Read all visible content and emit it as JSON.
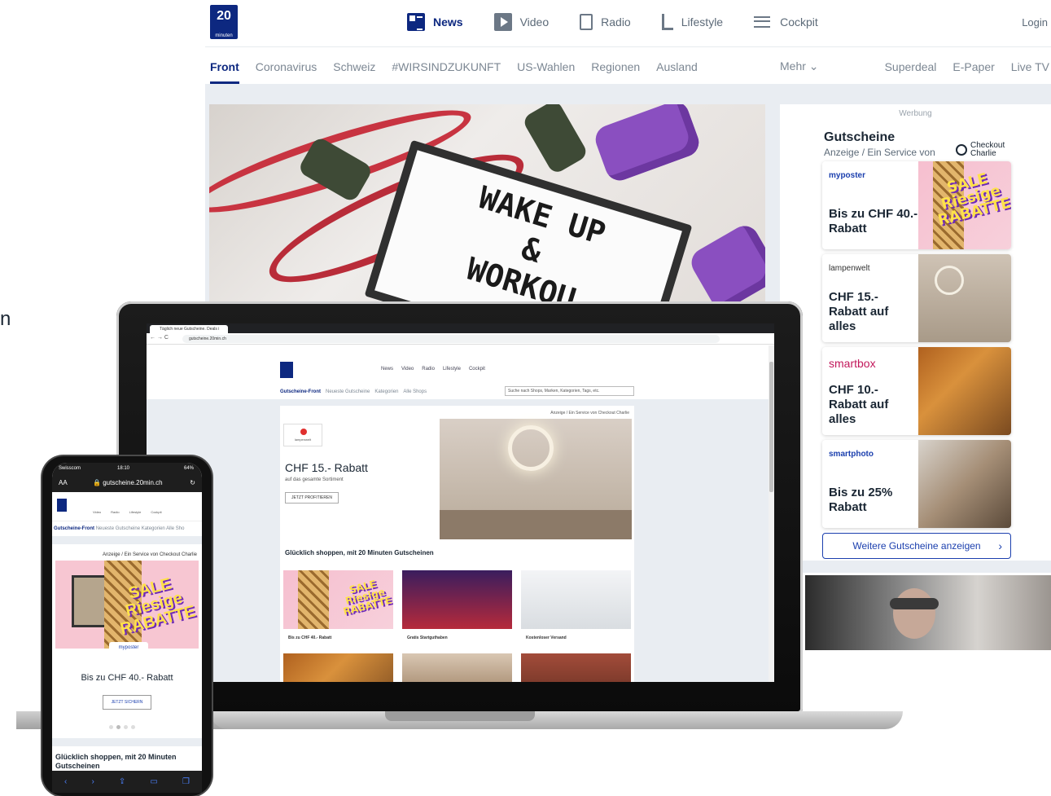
{
  "site": {
    "logo_text": "20",
    "logo_sub": "minuten",
    "nav": [
      {
        "label": "News",
        "icon": "news-icon"
      },
      {
        "label": "Video",
        "icon": "video-icon"
      },
      {
        "label": "Radio",
        "icon": "radio-icon"
      },
      {
        "label": "Lifestyle",
        "icon": "lifestyle-icon"
      },
      {
        "label": "Cockpit",
        "icon": "cockpit-icon"
      }
    ],
    "login": "Login",
    "tabs": [
      "Front",
      "Coronavirus",
      "Schweiz",
      "#WIRSINDZUKUNFT",
      "US-Wahlen",
      "Regionen",
      "Ausland"
    ],
    "mehr": "Mehr",
    "extra": [
      "Superdeal",
      "E-Paper",
      "Live TV"
    ],
    "hero_text_line1": "WAKE UP",
    "hero_text_line2": "&",
    "hero_text_line3": "WORKOU",
    "left_snip": "n"
  },
  "ad": {
    "werbung": "Werbung",
    "title": "Gutscheine",
    "subtitle": "Anzeige / Ein Service von",
    "partner_line1": "Checkout",
    "partner_line2": "Charlie",
    "cards": [
      {
        "brand": "myposter",
        "deal": "Bis zu CHF 40.- Rabatt",
        "image": "sale",
        "sale1": "SALE",
        "sale2": "Riesige",
        "sale3": "RABATTE"
      },
      {
        "brand": "lampenwelt",
        "deal": "CHF 15.- Rabatt auf alles",
        "image": "lamp"
      },
      {
        "brand": "smartbox",
        "deal": "CHF 10.- Rabatt auf alles",
        "image": "autumn"
      },
      {
        "brand": "smartphoto",
        "deal": "Bis zu 25% Rabatt",
        "image": "couple"
      }
    ],
    "more": "Weitere Gutscheine anzeigen"
  },
  "laptop": {
    "tab_title": "Täglich neue Gutscheine. Deals i",
    "url": "gutscheine.20min.ch",
    "nav": [
      "News",
      "Video",
      "Radio",
      "Lifestyle",
      "Cockpit"
    ],
    "tabs": [
      "Gutscheine-Front",
      "Neueste Gutscheine",
      "Kategorien",
      "Alle Shops"
    ],
    "search_placeholder": "Suche nach Shops, Marken, Kategorien, Tags, etc.",
    "anzeige": "Anzeige / Ein Service von Checkout Charlie",
    "brand": "lampenwelt",
    "title": "CHF 15.- Rabatt",
    "subline": "auf das gesamte Sortiment",
    "button": "JETZT PROFITIEREN",
    "section": "Glücklich shoppen, mit 20 Minuten Gutscheinen",
    "thumbs": [
      {
        "caption": "Bis zu CHF 40.- Rabatt",
        "image": "sale"
      },
      {
        "caption": "Gratis Startguthaben",
        "image": "casino"
      },
      {
        "caption": "Kostenloser Versand",
        "image": "courier"
      },
      {
        "caption": "",
        "image": "autumn"
      },
      {
        "caption": "",
        "image": "coffee"
      },
      {
        "caption": "",
        "image": "meat"
      }
    ]
  },
  "phone": {
    "carrier": "Swisscom",
    "time": "18:10",
    "battery": "64%",
    "aa": "AA",
    "url": "gutscheine.20min.ch",
    "nav": [
      "Video",
      "Radio",
      "Lifestyle",
      "Cockpit"
    ],
    "tab_active": "Gutscheine-Front",
    "tabs_rest": "Neueste Gutscheine  Kategorien  Alle Sho",
    "anzeige": "Anzeige / Ein Service von Checkout Charlie",
    "brand": "myposter",
    "deal": "Bis zu CHF 40.- Rabatt",
    "button": "JETZT SICHERN",
    "section": "Glücklich shoppen, mit 20 Minuten Gutscheinen"
  },
  "colors": {
    "brand_blue": "#0d2880",
    "link_blue": "#1b3fae",
    "page_gray": "#e9edf2"
  }
}
